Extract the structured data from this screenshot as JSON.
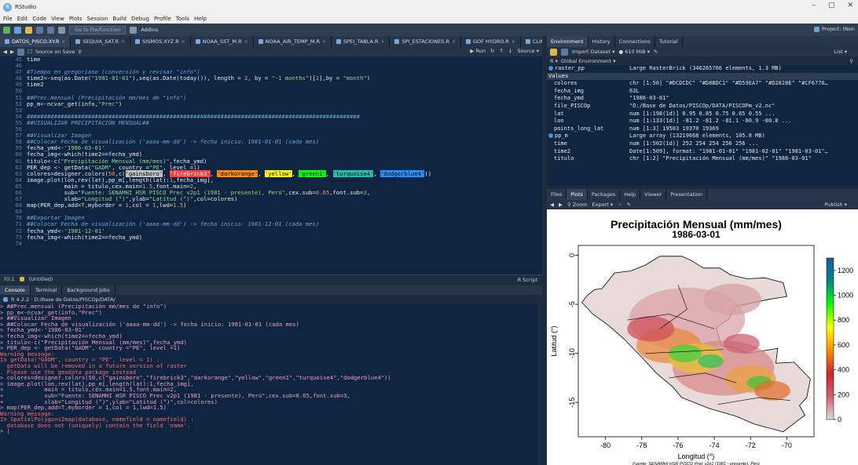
{
  "window": {
    "title": "RStudio",
    "project": "Project: (Non"
  },
  "menu": [
    "File",
    "Edit",
    "Code",
    "View",
    "Plots",
    "Session",
    "Build",
    "Debug",
    "Profile",
    "Tools",
    "Help"
  ],
  "toolbar": {
    "goto_placeholder": "Go to file/function",
    "addins": "Addins"
  },
  "editor": {
    "tabs": [
      "DATOS_PISCO.XY.R",
      "SEQUIA_SAT.R",
      "SISMOS.XYZ.R",
      "NOAA_SST_M.R",
      "NOAA_AIR_TEMP_M.R",
      "SPEI_TABLA.R",
      "SPI_ESTACIONES.R",
      "GOF HYDRO.R",
      "CLIMATO"
    ],
    "source_on_save": "Source on Save",
    "run": "Run",
    "source": "Source",
    "status_pos": "70:1",
    "status_scope": "(Untitled)",
    "status_lang": "R Script"
  },
  "console": {
    "tabs": [
      "Console",
      "Terminal",
      "Background Jobs"
    ],
    "path": "R 4.2.2 · D:/Base de Datos/PISCOp/DATA/"
  },
  "environment": {
    "tabs": [
      "Environment",
      "History",
      "Connections",
      "Tutorial"
    ],
    "import": "Import Dataset",
    "memory": "610 MiB",
    "list": "List",
    "scope": "Global Environment",
    "rows": [
      {
        "name": "raster_pp",
        "value": "Large RasterBrick (346265766 elements, 1.3 MB)",
        "kind": "data"
      },
      {
        "name": "Values",
        "value": "",
        "kind": "header"
      },
      {
        "name": "colores",
        "value": "chr [1:50] \"#DCDCDC\" \"#D8BDC1\" \"#D59EA7\" \"#D2828E\" \"#CF6776…",
        "kind": "value"
      },
      {
        "name": "fecha_img",
        "value": "63L",
        "kind": "value"
      },
      {
        "name": "fecha_ymd",
        "value": "\"1986-03-01\"",
        "kind": "value"
      },
      {
        "name": "file_PISCOp",
        "value": "\"D:/Base de Datos/PISCOp/DATA/PISCOPm_v2.nc\"",
        "kind": "value"
      },
      {
        "name": "lat",
        "value": "num [1:198(1d)] 0.95 0.85 0.75 0.65 0.55 ...",
        "kind": "value"
      },
      {
        "name": "lon",
        "value": "num [1:133(1d)] -81.2 -81.2 -81.1 -80.9 -80.8 ...",
        "kind": "value"
      },
      {
        "name": "points_long_lat",
        "value": "num [1:3] 19503 19370 19369",
        "kind": "value"
      },
      {
        "name": "pp_m",
        "value": "Large array (13219668 elements, 105.8 MB)",
        "kind": "data"
      },
      {
        "name": "time",
        "value": "num [1:502(1d)] 252 254 254 256 256 ...",
        "kind": "value"
      },
      {
        "name": "time2",
        "value": "Date[1:509], format: \"1981-01-01\" \"1981-02-01\" \"1981-03-01\"…",
        "kind": "value"
      },
      {
        "name": "titulo",
        "value": "chr [1:2] \"Precipitación Mensual (mm/mes)\" \"1986-03-01\"",
        "kind": "value"
      }
    ]
  },
  "plots": {
    "tabs": [
      "Files",
      "Plots",
      "Packages",
      "Help",
      "Viewer",
      "Presentation"
    ],
    "zoom": "Zoom",
    "export": "Export",
    "publish": "Publish"
  },
  "chart_data": {
    "type": "heatmap",
    "title": "Precipitación Mensual (mm/mes)",
    "subtitle": "1986-03-01",
    "xlabel": "Longitud (°)",
    "ylabel": "Latitud (°)",
    "caption": "Fuente: SENAMHI HSR PISCO Prec v2p1 (1981 - presente), Perú",
    "x_ticks": [
      -80,
      -78,
      -76,
      -74,
      -72,
      -70
    ],
    "y_ticks": [
      0,
      -5,
      -10,
      -15
    ],
    "xlim": [
      -81.5,
      -68.5
    ],
    "ylim": [
      -18.5,
      1
    ],
    "colorbar_ticks": [
      0,
      200,
      400,
      600,
      800,
      1000,
      1200
    ],
    "colorbar_range": [
      0,
      1300
    ],
    "colors": [
      "#DCDCDC",
      "#B22222",
      "#FF8C00",
      "#FFFF00",
      "#00FF00",
      "#00868B",
      "#1E90FF"
    ]
  }
}
